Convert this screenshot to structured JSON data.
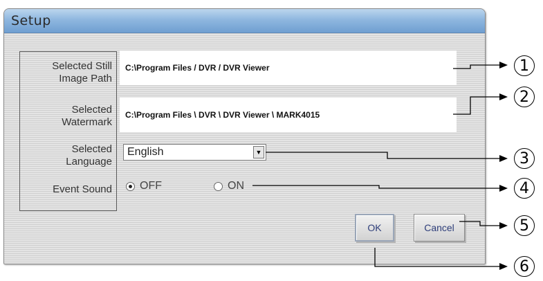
{
  "dialog": {
    "title": "Setup",
    "labels": {
      "still_image_path": "Selected Still\nImage Path",
      "watermark": "Selected\nWatermark",
      "language": "Selected\nLanguage",
      "event_sound": "Event Sound"
    },
    "still_image_path_value": "C:\\Program Files / DVR / DVR Viewer",
    "watermark_value": "C:\\Program Files \\ DVR \\ DVR Viewer \\ MARK4015",
    "language_selected": "English",
    "event_sound": {
      "off_label": "OFF",
      "on_label": "ON",
      "selected": "OFF"
    },
    "buttons": {
      "ok": "OK",
      "cancel": "Cancel"
    }
  },
  "callouts": [
    "1",
    "2",
    "3",
    "4",
    "5",
    "6"
  ]
}
